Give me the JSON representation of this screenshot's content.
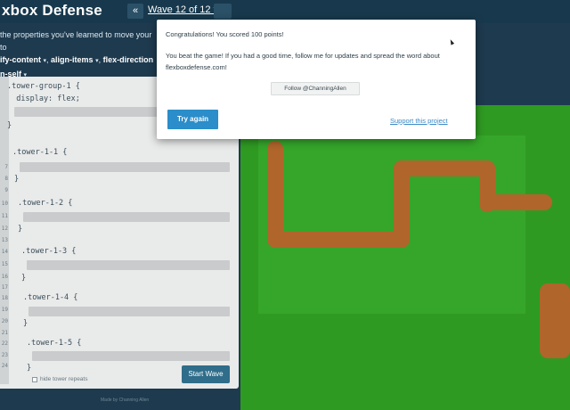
{
  "app": {
    "title": "xbox Defense"
  },
  "nav": {
    "prev_label": "«",
    "wave_label": "Wave 12 of 12 ▾"
  },
  "instructions": {
    "line1": "the properties you've learned to move your to",
    "props": [
      "ify-content",
      "align-items",
      "flex-direction"
    ],
    "last_prop": "n-self"
  },
  "editor": {
    "line_numbers": [
      "7",
      "8",
      "9",
      "10",
      "11",
      "12",
      "13",
      "14",
      "15",
      "16",
      "17",
      "18",
      "19",
      "20",
      "21",
      "22",
      "23",
      "24"
    ],
    "top_lines": [
      ".tower-group-1 {",
      "  display: flex;"
    ],
    "blocks": [
      ".tower-1-1 {",
      ".tower-1-2 {",
      ".tower-1-3 {",
      ".tower-1-4 {",
      ".tower-1-5 {"
    ],
    "close_brace": "}",
    "hide_label": "hide tower repeats",
    "start_label": "Start Wave",
    "made_by": "Made by Channing Allen"
  },
  "modal": {
    "title": "Congratulations! You scored 100 points!",
    "body": "You beat the game! If you had a good time, follow me for updates and spread the word about flexboxdefense.com!",
    "follow_label": "Follow @ChanningAllen",
    "try_again_label": "Try again",
    "support_label": "Support this project"
  },
  "colors": {
    "accent": "#2b8dc9",
    "panel": "#18394d",
    "grass": "#2f9a22",
    "path": "#b0652b"
  }
}
